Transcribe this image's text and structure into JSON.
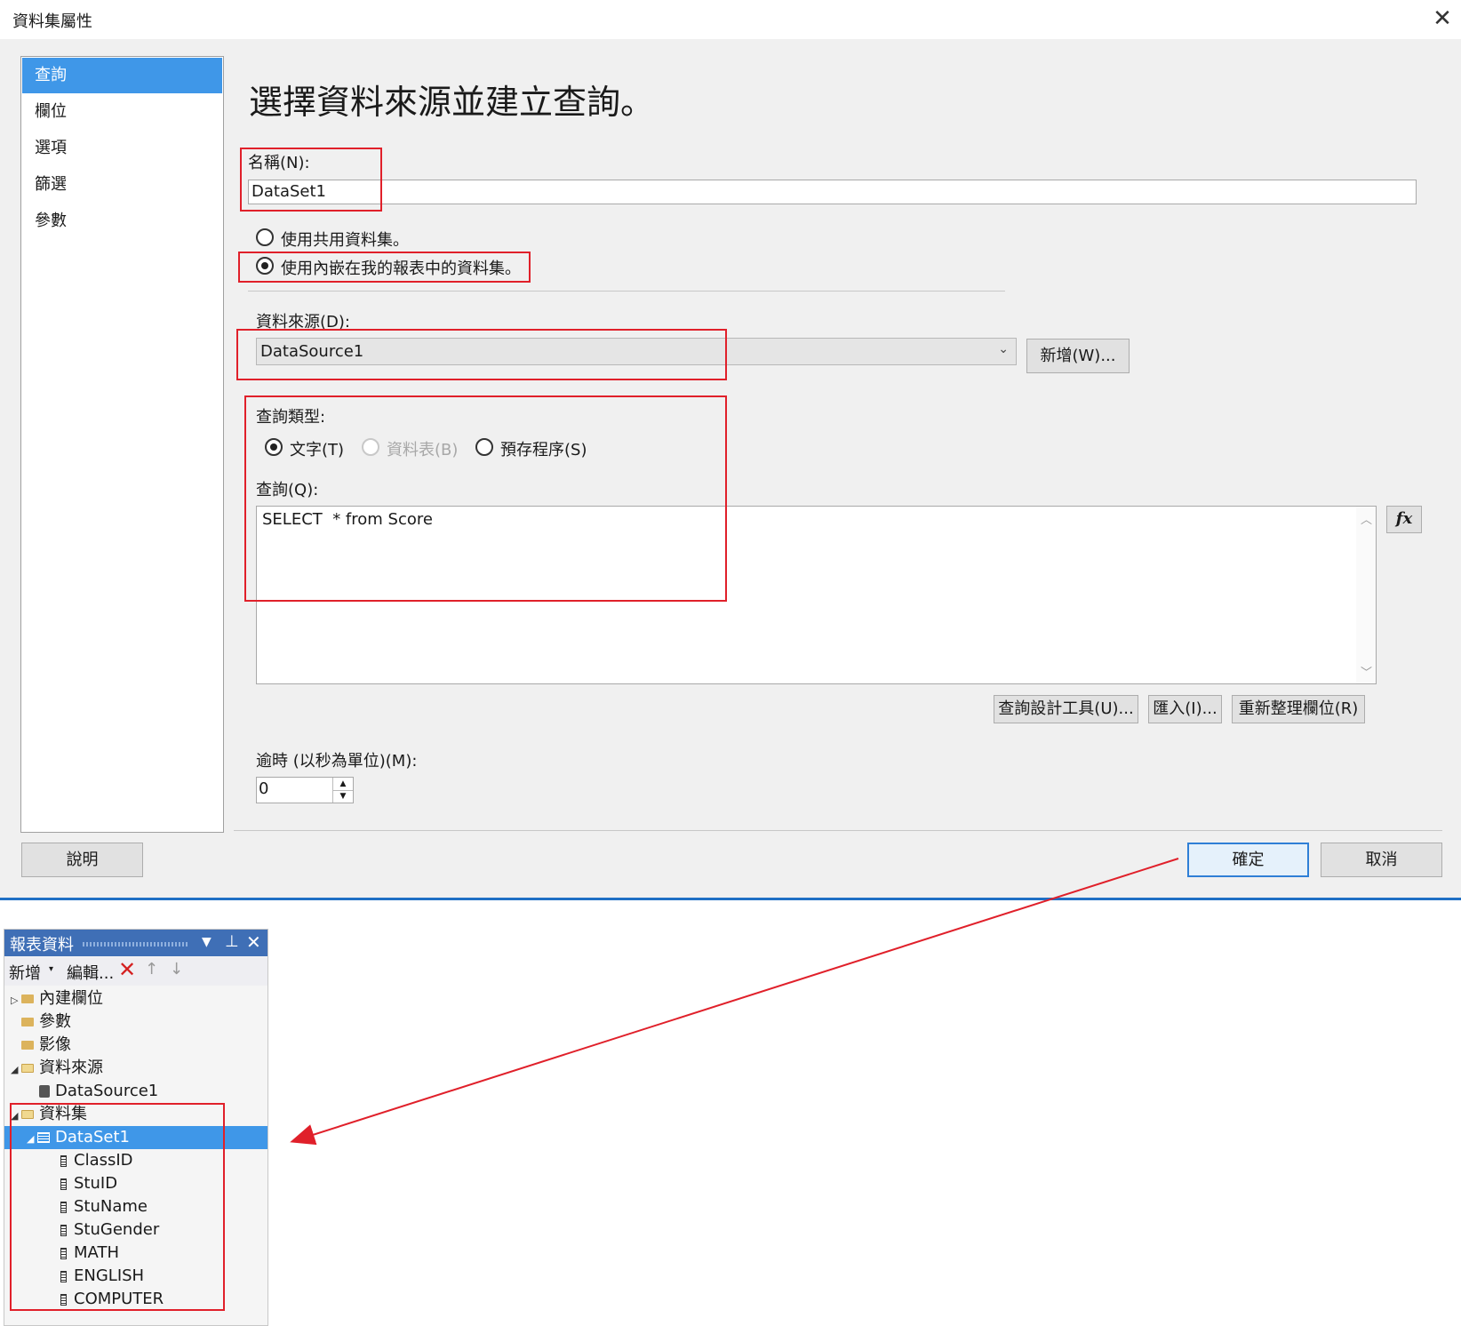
{
  "dialog": {
    "title": "資料集屬性",
    "nav": [
      "查詢",
      "欄位",
      "選項",
      "篩選",
      "參數"
    ],
    "heading": "選擇資料來源並建立查詢。",
    "name_label": "名稱(N):",
    "name_value": "DataSet1",
    "radio_shared": "使用共用資料集。",
    "radio_embedded": "使用內嵌在我的報表中的資料集。",
    "datasource_label": "資料來源(D):",
    "datasource_value": "DataSource1",
    "new_button": "新增(W)...",
    "query_type_label": "查詢類型:",
    "query_type_text": "文字(T)",
    "query_type_table": "資料表(B)",
    "query_type_sp": "預存程序(S)",
    "query_label": "查詢(Q):",
    "query_text": "SELECT  * from Score",
    "fx_button": "fx",
    "query_designer_button": "查詢設計工具(U)...",
    "import_button": "匯入(I)...",
    "refresh_fields_button": "重新整理欄位(R)",
    "timeout_label": "逾時 (以秒為單位)(M):",
    "timeout_value": "0",
    "help_button": "說明",
    "ok_button": "確定",
    "cancel_button": "取消"
  },
  "report_data": {
    "title": "報表資料",
    "toolbar_new": "新增",
    "toolbar_edit": "編輯...",
    "built_in_fields": "內建欄位",
    "parameters": "參數",
    "images": "影像",
    "data_sources": "資料來源",
    "data_source_item": "DataSource1",
    "datasets": "資料集",
    "dataset_item": "DataSet1",
    "fields": [
      "ClassID",
      "StuID",
      "StuName",
      "StuGender",
      "MATH",
      "ENGLISH",
      "COMPUTER"
    ]
  },
  "colors": {
    "accent": "#3f97e8",
    "annotation": "#e0202a",
    "panel_header": "#3f6fb6"
  }
}
